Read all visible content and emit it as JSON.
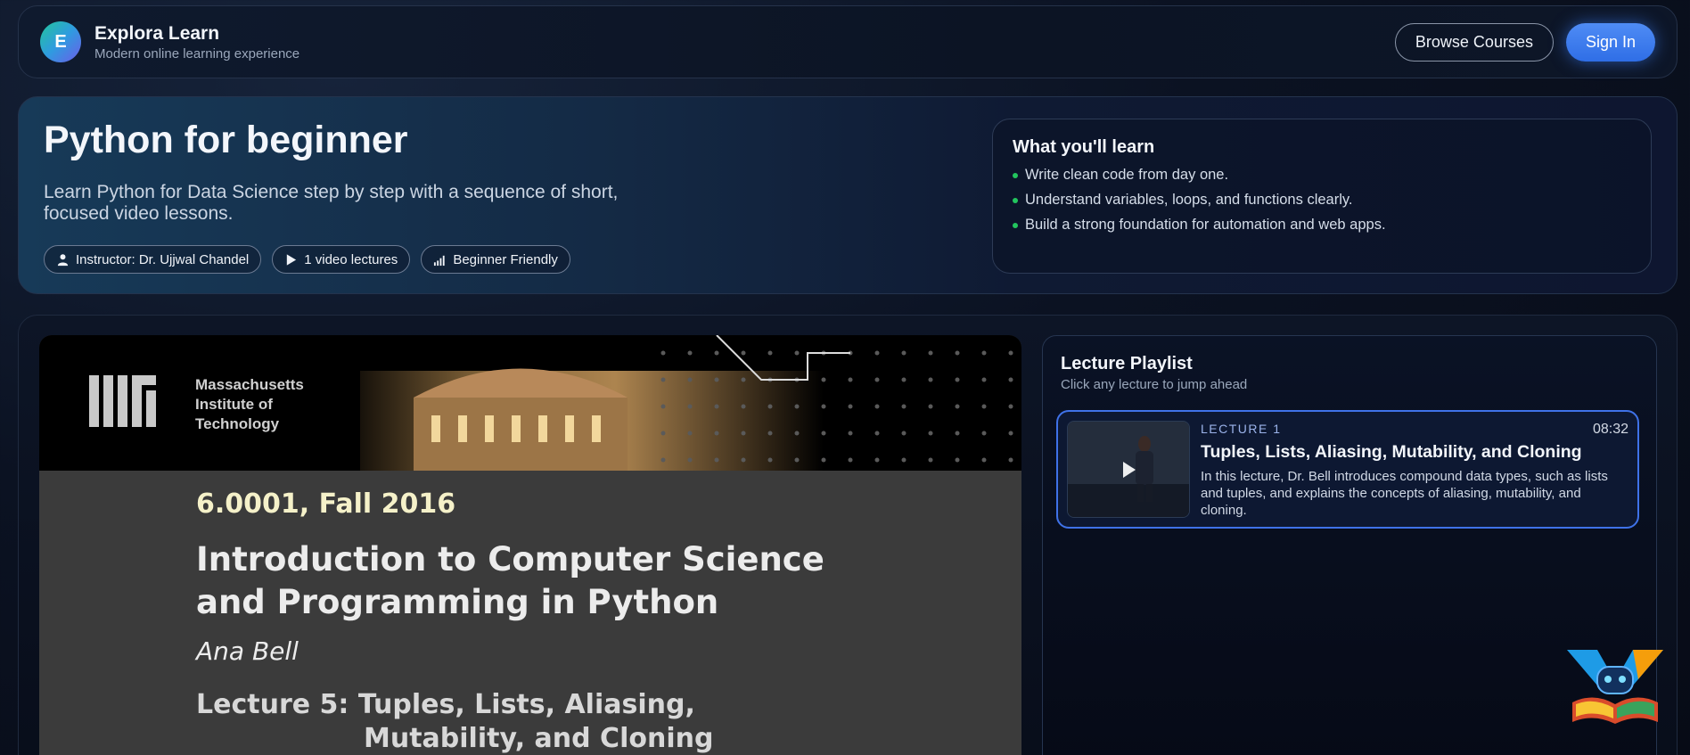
{
  "header": {
    "logo_letter": "E",
    "brand_title": "Explora Learn",
    "brand_subtitle": "Modern online learning experience",
    "browse_label": "Browse Courses",
    "signin_label": "Sign In"
  },
  "hero": {
    "title": "Python for beginner",
    "description": "Learn Python for Data Science step by step with a sequence of short, focused video lessons.",
    "chips": {
      "instructor": "Instructor: Dr. Ujjwal Chandel",
      "lectures": "1 video lectures",
      "level": "Beginner Friendly"
    },
    "learn": {
      "title": "What you'll learn",
      "items": [
        "Write clean code from day one.",
        "Understand variables, loops, and functions clearly.",
        "Build a strong foundation for automation and web apps."
      ]
    }
  },
  "video": {
    "institution": [
      "Massachusetts",
      "Institute of",
      "Technology"
    ],
    "course": "6.0001, Fall 2016",
    "title_line1": "Introduction to Computer Science",
    "title_line2": "and Programming in Python",
    "author": "Ana Bell",
    "lecture_line1": "Lecture 5: Tuples, Lists, Aliasing,",
    "lecture_line2": "Mutability, and Cloning"
  },
  "playlist": {
    "title": "Lecture Playlist",
    "subtitle": "Click any lecture to jump ahead",
    "items": [
      {
        "number": "LECTURE 1",
        "duration": "08:32",
        "title": "Tuples, Lists, Aliasing, Mutability, and Cloning",
        "description": "In this lecture, Dr. Bell introduces compound data types, such as lists and tuples, and explains the concepts of aliasing, mutability, and cloning."
      }
    ]
  },
  "colors": {
    "accent": "#3f72e8",
    "bullet": "#22c55e",
    "primary_button": "#2f6ee6"
  },
  "icons": [
    "person-icon",
    "play-icon",
    "signal-bars-icon",
    "play-overlay-icon",
    "robot-mascot-icon"
  ]
}
